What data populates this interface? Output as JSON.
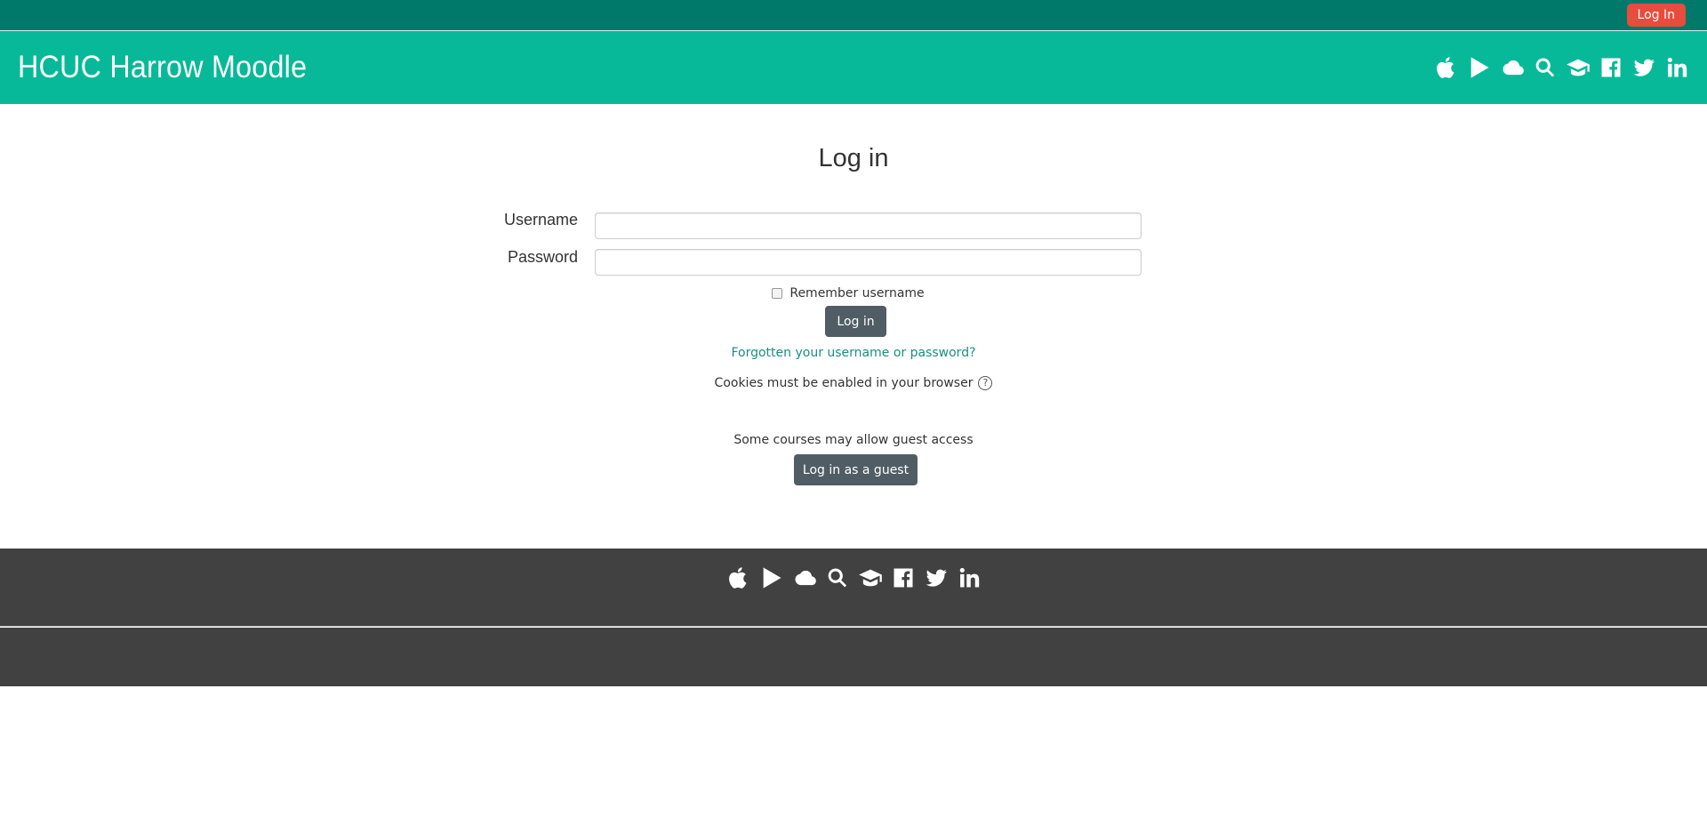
{
  "topbar": {
    "login_label": "Log In"
  },
  "header": {
    "site_title": "HCUC Harrow Moodle",
    "icons": [
      "apple-icon",
      "play-store-icon",
      "cloud-icon",
      "search-icon",
      "graduation-cap-icon",
      "facebook-icon",
      "twitter-icon",
      "linkedin-icon"
    ]
  },
  "login": {
    "title": "Log in",
    "username_label": "Username",
    "username_value": "",
    "password_label": "Password",
    "password_value": "",
    "remember_label": "Remember username",
    "submit_label": "Log in",
    "forgot_link": "Forgotten your username or password?",
    "cookies_note": "Cookies must be enabled in your browser",
    "guest_note": "Some courses may allow guest access",
    "guest_button": "Log in as a guest"
  },
  "colors": {
    "topbar": "#00796b",
    "header": "#07b999",
    "login_button": "#e74c3c",
    "dark_button": "#505d65",
    "link": "#1b8e80",
    "footer": "#414141"
  }
}
